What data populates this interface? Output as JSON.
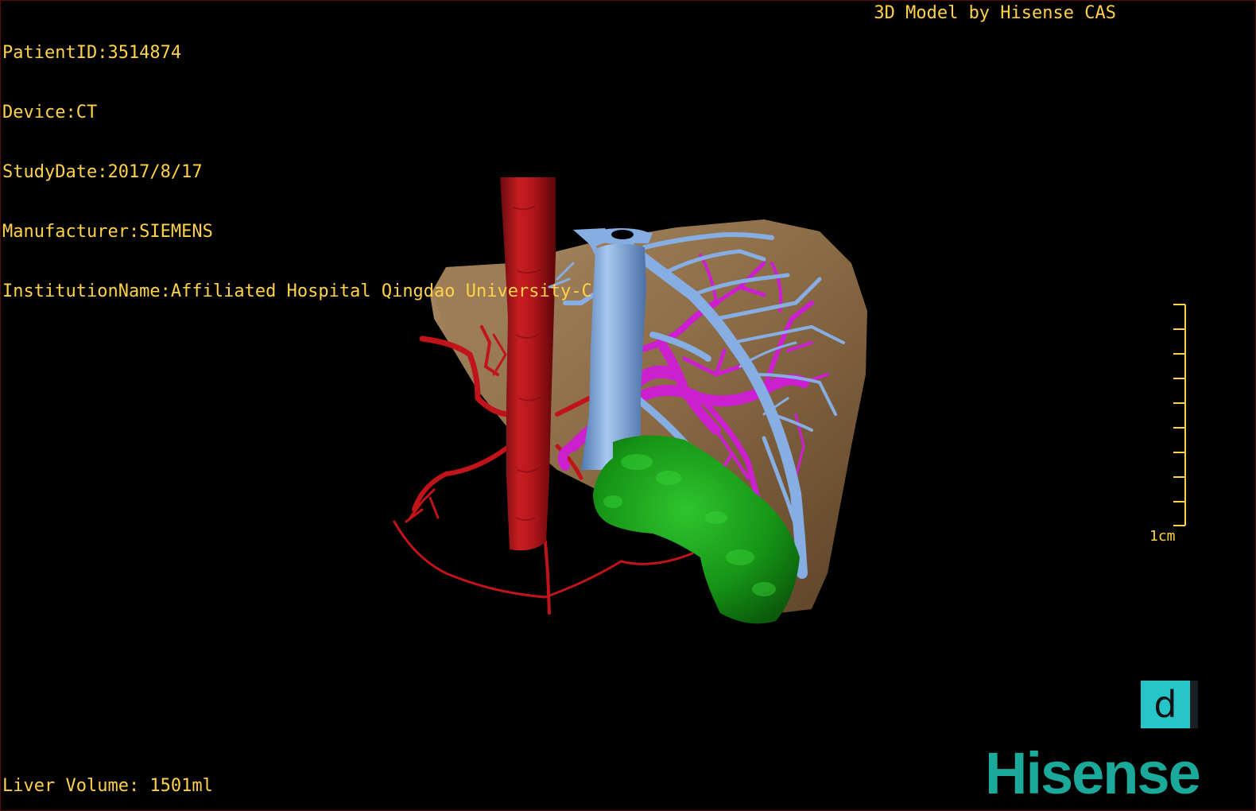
{
  "overlay": {
    "patient_id": "PatientID:3514874",
    "device": "Device:CT",
    "study_date": "StudyDate:2017/8/17",
    "manufacturer": "Manufacturer:SIEMENS",
    "institution": "InstitutionName:Affiliated Hospital Qingdao University-C",
    "brand_caption": "3D Model by Hisense CAS",
    "liver_volume": "Liver Volume: 1501ml"
  },
  "scale": {
    "label": "1cm"
  },
  "toolbar": {
    "mode_button_glyph": "d"
  },
  "branding": {
    "logo_text": "Hisense",
    "logo_color": "#1aa99a"
  },
  "colors": {
    "text": "#ffd24a",
    "liver": "#8a6a45",
    "aorta": "#b0161c",
    "vena_cava": "#79a6e0",
    "portal_vein": "#cc1fd0",
    "tumor": "#1a9a1a",
    "arteries": "#c0141a"
  }
}
